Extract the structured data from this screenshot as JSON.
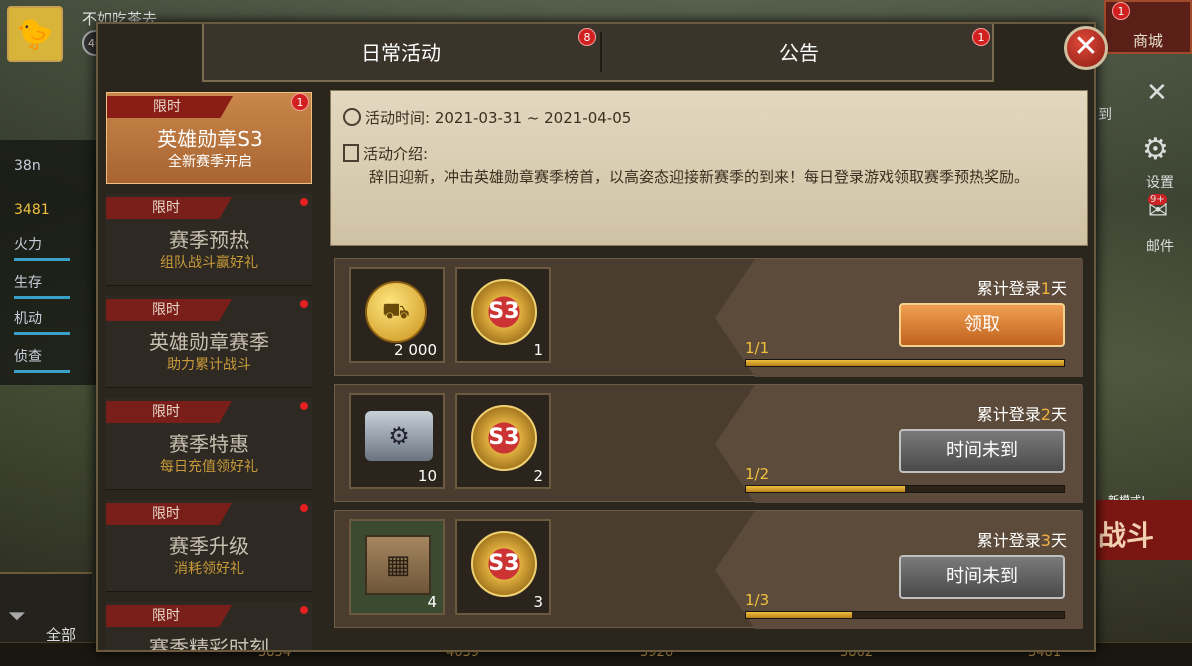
{
  "player": {
    "name": "不如吃茶去",
    "level": "40"
  },
  "hud": {
    "shop": "商城",
    "shop_badge": "1",
    "settings": "设置",
    "mail": "邮件",
    "mail_badge": "9+",
    "rank_label": "到",
    "new_mode": "新模式!",
    "battle": "战斗",
    "filter_all": "全部",
    "gold_value": "3481",
    "power_value": "38n",
    "stats": [
      "火力",
      "生存",
      "机动",
      "侦查"
    ],
    "bottom_values": [
      "3854",
      "4639",
      "3926",
      "3862",
      "3481"
    ]
  },
  "tabs": [
    {
      "label": "日常活动",
      "badge": "8"
    },
    {
      "label": "公告",
      "badge": "1"
    }
  ],
  "sidebar": [
    {
      "tag": "限时",
      "title": "英雄勋章S3",
      "subtitle": "全新赛季开启",
      "badge": "1"
    },
    {
      "tag": "限时",
      "title": "赛季预热",
      "subtitle": "组队战斗赢好礼"
    },
    {
      "tag": "限时",
      "title": "英雄勋章赛季",
      "subtitle": "助力累计战斗"
    },
    {
      "tag": "限时",
      "title": "赛季特惠",
      "subtitle": "每日充值领好礼"
    },
    {
      "tag": "限时",
      "title": "赛季升级",
      "subtitle": "消耗领好礼"
    },
    {
      "tag": "限时",
      "title": "赛季精彩时刻",
      "subtitle": ""
    }
  ],
  "info": {
    "time_label": "活动时间:",
    "time_value": "2021-03-31 ~ 2021-04-05",
    "intro_label": "活动介绍:",
    "intro_text": "辞旧迎新，冲击英雄勋章赛季榜首，以高姿态迎接新赛季的到来！每日登录游戏领取赛季预热奖励。"
  },
  "rewards": [
    {
      "title_pre": "累计登录",
      "day": "1",
      "title_post": "天",
      "item1_count": "2 000",
      "item2_count": "1",
      "progress_text": "1/1",
      "progress": 1.0,
      "button": "领取"
    },
    {
      "title_pre": "累计登录",
      "day": "2",
      "title_post": "天",
      "item1_count": "10",
      "item2_count": "2",
      "progress_text": "1/2",
      "progress": 0.5,
      "button": "时间未到"
    },
    {
      "title_pre": "累计登录",
      "day": "3",
      "title_post": "天",
      "item1_count": "4",
      "item2_count": "3",
      "progress_text": "1/3",
      "progress": 0.333,
      "button": "时间未到"
    }
  ],
  "icons": {
    "medal_text": "S3",
    "close": "close-icon"
  }
}
